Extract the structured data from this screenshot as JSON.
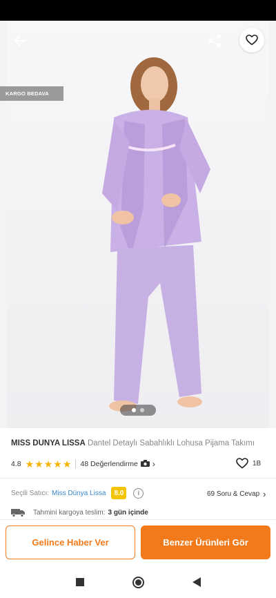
{
  "header": {
    "back_icon": "arrow-left-icon",
    "share_icon": "share-icon",
    "favorite_icon": "heart-outline-icon"
  },
  "badge": {
    "label": "KARGO BEDAVA"
  },
  "gallery": {
    "current_page": 1,
    "total_pages": 2
  },
  "product": {
    "brand": "MİSS DÜNYA LİSSA",
    "name": "Dantel Detaylı Sabahlıklı Lohusa Pijama Takımı",
    "rating": "4.8",
    "stars_filled": 5,
    "review_count_text": "48 Değerlendirme",
    "camera_icon": "camera-icon",
    "like_count": "1B"
  },
  "seller": {
    "label": "Seçili Satıcı:",
    "name": "Miss Dünya Lissa",
    "score": "8.0",
    "qa_text": "69 Soru & Cevap"
  },
  "shipping": {
    "icon": "truck-icon",
    "label": "Tahmini kargoya teslim:",
    "value": "3 gün içinde"
  },
  "actions": {
    "notify_label": "Gelince Haber Ver",
    "similar_label": "Benzer Ürünleri Gör"
  },
  "colors": {
    "accent": "#f27a1a",
    "star": "#f5b301",
    "seller_link": "#3a86c8",
    "score_badge": "#f5c400"
  }
}
